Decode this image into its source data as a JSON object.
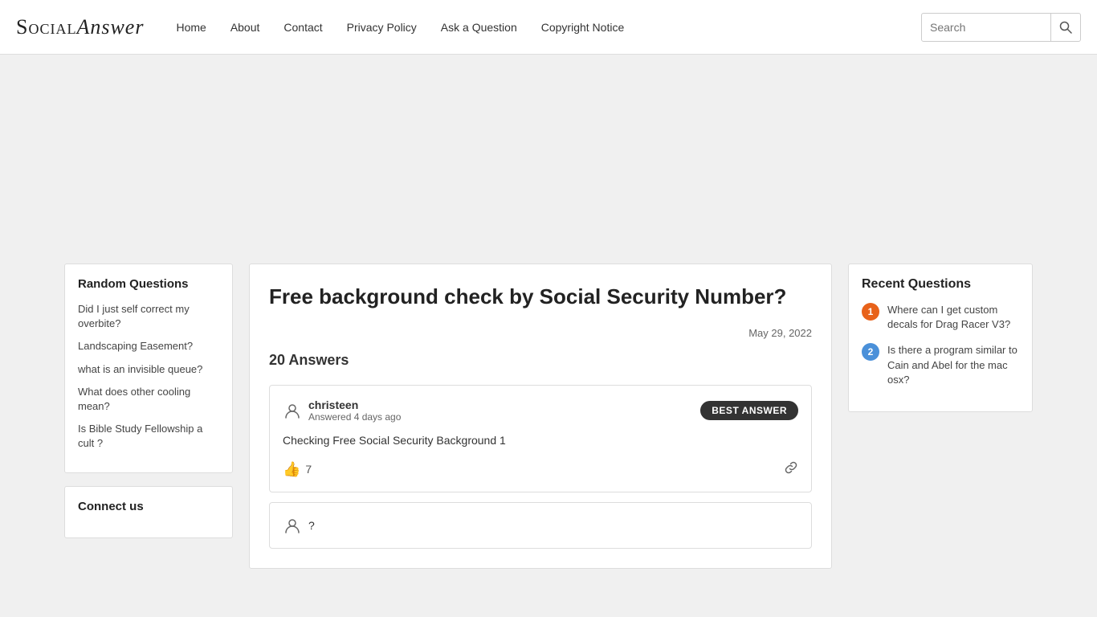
{
  "header": {
    "logo_social": "Social",
    "logo_answer": "Answer",
    "nav": {
      "home": "Home",
      "about": "About",
      "contact": "Contact",
      "privacy_policy": "Privacy Policy",
      "ask_a_question": "Ask a Question",
      "copyright_notice": "Copyright Notice"
    },
    "search_placeholder": "Search"
  },
  "sidebar": {
    "random_questions_title": "Random Questions",
    "questions": [
      {
        "text": "Did I just self correct my overbite?"
      },
      {
        "text": "Landscaping Easement?"
      },
      {
        "text": "what is an invisible queue?"
      },
      {
        "text": "What does other cooling mean?"
      },
      {
        "text": "Is Bible Study Fellowship a cult ?"
      }
    ],
    "connect_us_title": "Connect us"
  },
  "main": {
    "question_title": "Free background check by Social Security Number?",
    "question_date": "May 29, 2022",
    "answers_count": "20 Answers",
    "answers": [
      {
        "username": "christeen",
        "answered_time": "Answered 4 days ago",
        "is_best": true,
        "best_label": "BEST ANSWER",
        "body": "Checking Free Social Security Background 1",
        "likes": "7"
      },
      {
        "username": "?",
        "answered_time": "",
        "is_best": false,
        "body": "",
        "likes": ""
      }
    ]
  },
  "right_sidebar": {
    "title": "Recent Questions",
    "questions": [
      {
        "number": "1",
        "color": "orange",
        "text": "Where can I get custom decals for Drag Racer V3?"
      },
      {
        "number": "2",
        "color": "blue",
        "text": "Is there a program similar to Cain and Abel for the mac osx?"
      }
    ]
  }
}
